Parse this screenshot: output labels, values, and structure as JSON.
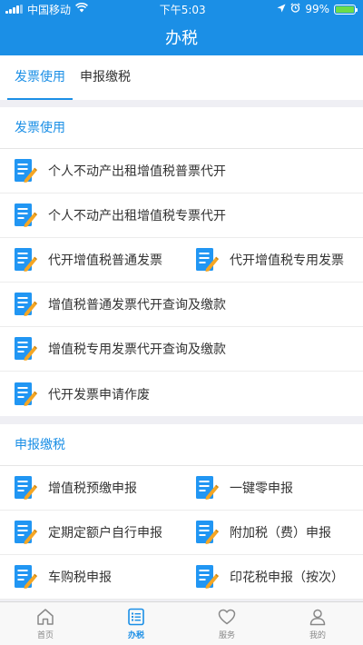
{
  "status_bar": {
    "carrier": "中国移动",
    "time": "下午5:03",
    "battery": "99%",
    "battery_level": 0.99
  },
  "nav": {
    "title": "办税"
  },
  "tabs": [
    {
      "label": "发票使用",
      "active": true
    },
    {
      "label": "申报缴税",
      "active": false
    }
  ],
  "sections": [
    {
      "title": "发票使用",
      "items": [
        "个人不动产出租增值税普票代开",
        "个人不动产出租增值税专票代开",
        "代开增值税普通发票",
        "代开增值税专用发票",
        "增值税普通发票代开查询及缴款",
        "增值税专用发票代开查询及缴款",
        "代开发票申请作废"
      ]
    },
    {
      "title": "申报缴税",
      "items": [
        "增值税预缴申报",
        "一键零申报",
        "定期定额户自行申报",
        "附加税（费）申报",
        "车购税申报",
        "印花税申报（按次）"
      ]
    }
  ],
  "tabbar": [
    {
      "label": "首页",
      "icon": "home-icon"
    },
    {
      "label": "办税",
      "icon": "list-icon",
      "active": true
    },
    {
      "label": "服务",
      "icon": "heart-icon"
    },
    {
      "label": "我的",
      "icon": "person-icon"
    }
  ],
  "colors": {
    "primary": "#1b8fe6",
    "icon_blue": "#2196f3",
    "icon_yellow": "#f5a623"
  }
}
